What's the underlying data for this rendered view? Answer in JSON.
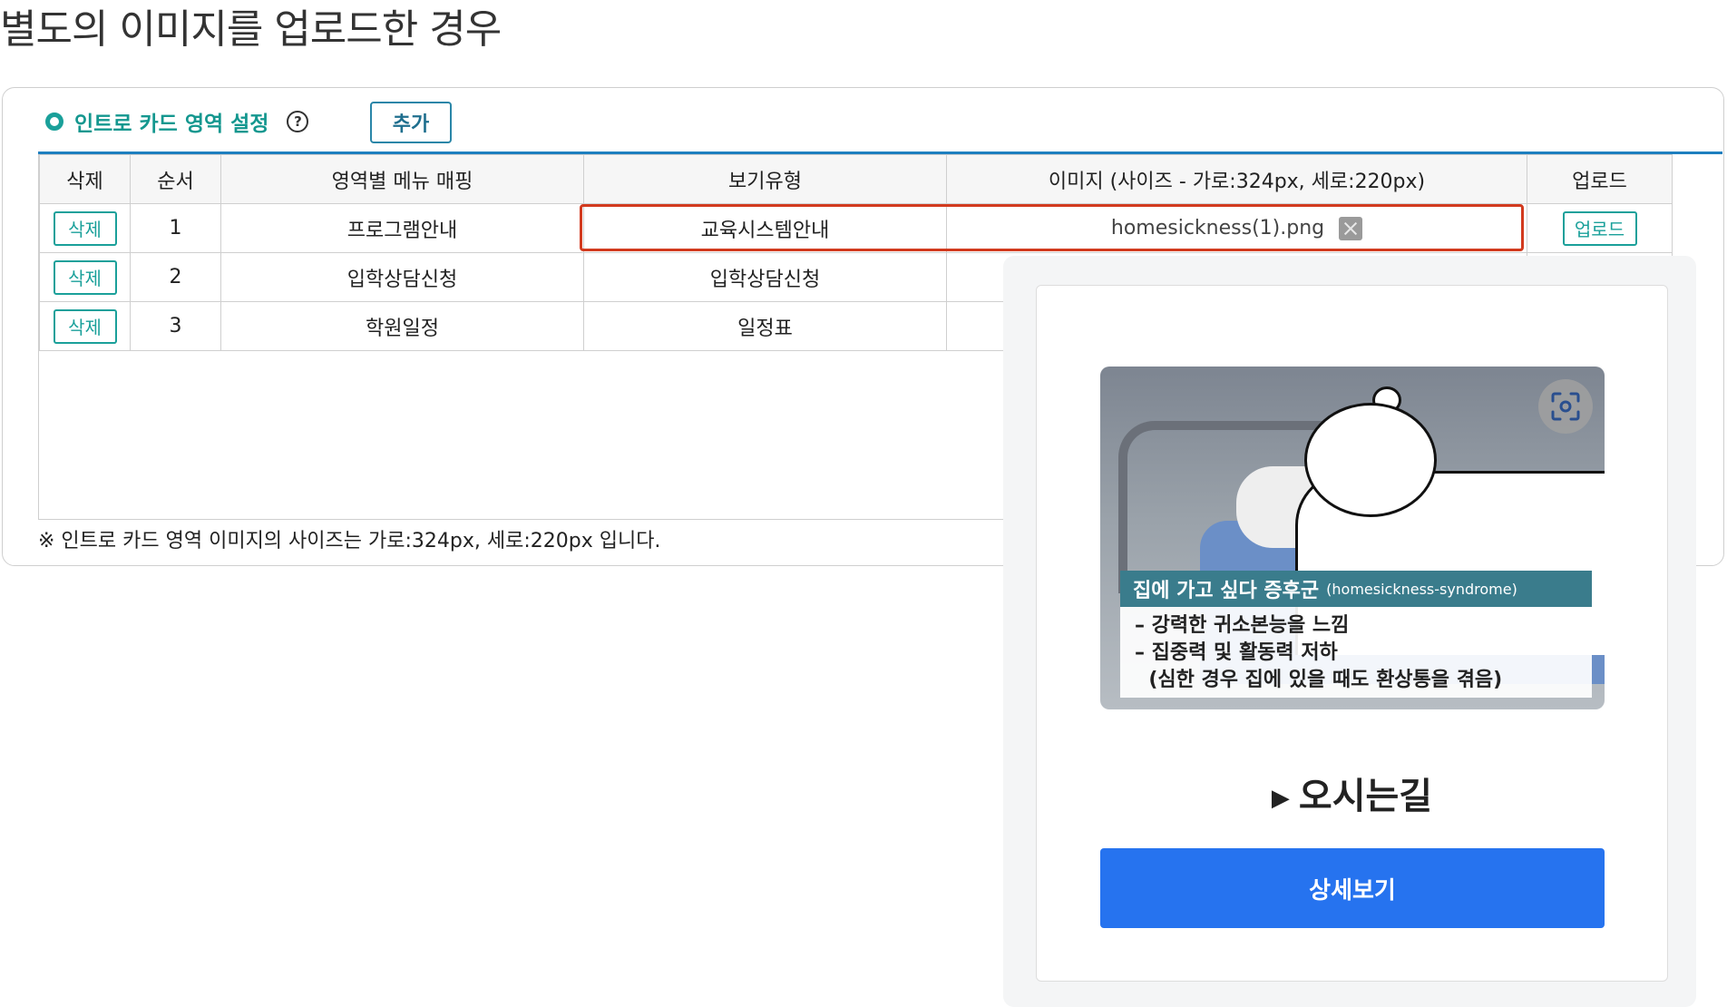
{
  "page_title": "별도의 이미지를 업로드한 경우",
  "section": {
    "title": "인트로 카드 영역 설정",
    "help_icon": "?",
    "add_label": "추가"
  },
  "table": {
    "headers": [
      "삭제",
      "순서",
      "영역별 메뉴 매핑",
      "보기유형",
      "이미지 (사이즈 - 가로:324px, 세로:220px)",
      "업로드"
    ],
    "rows": [
      {
        "delete": "삭제",
        "order": "1",
        "menu": "프로그램안내",
        "view_type": "교육시스템안내",
        "image": "homesickness(1).png",
        "upload": "업로드"
      },
      {
        "delete": "삭제",
        "order": "2",
        "menu": "입학상담신청",
        "view_type": "입학상담신청"
      },
      {
        "delete": "삭제",
        "order": "3",
        "menu": "학원일정",
        "view_type": "일정표"
      }
    ]
  },
  "note": "※ 인트로 카드 영역 이미지의 사이즈는 가로:324px, 세로:220px 입니다.",
  "preview": {
    "image": {
      "caption_title": "집에 가고 싶다 증후군",
      "caption_sub": "(homesickness-syndrome)",
      "caption_lines": "– 강력한 귀소본능을 느낌\n– 집중력 및 활동력 저하\n  (심한 경우 집에 있을 때도 환상통을 겪음)"
    },
    "title": "오시는길",
    "button_label": "상세보기"
  }
}
